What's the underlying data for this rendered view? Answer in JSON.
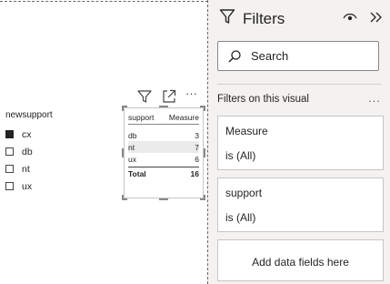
{
  "slicer": {
    "title": "newsupport",
    "items": [
      {
        "label": "cx",
        "checked": true
      },
      {
        "label": "db",
        "checked": false
      },
      {
        "label": "nt",
        "checked": false
      },
      {
        "label": "ux",
        "checked": false
      }
    ]
  },
  "visual_header": {
    "icons": [
      "filter-icon",
      "focus-mode-icon",
      "more-options-icon"
    ],
    "more_label": "···"
  },
  "table": {
    "headers": [
      "support",
      "Measure"
    ],
    "rows": [
      {
        "support": "db",
        "measure": "3"
      },
      {
        "support": "nt",
        "measure": "7"
      },
      {
        "support": "ux",
        "measure": "6"
      }
    ],
    "total_label": "Total",
    "total_value": "16"
  },
  "filters_pane": {
    "title": "Filters",
    "search_placeholder": "Search",
    "section_label": "Filters on this visual",
    "section_more": "...",
    "cards": [
      {
        "title": "Measure",
        "value": "is (All)"
      },
      {
        "title": "support",
        "value": "is (All)"
      }
    ],
    "add_fields_label": "Add data fields here"
  }
}
